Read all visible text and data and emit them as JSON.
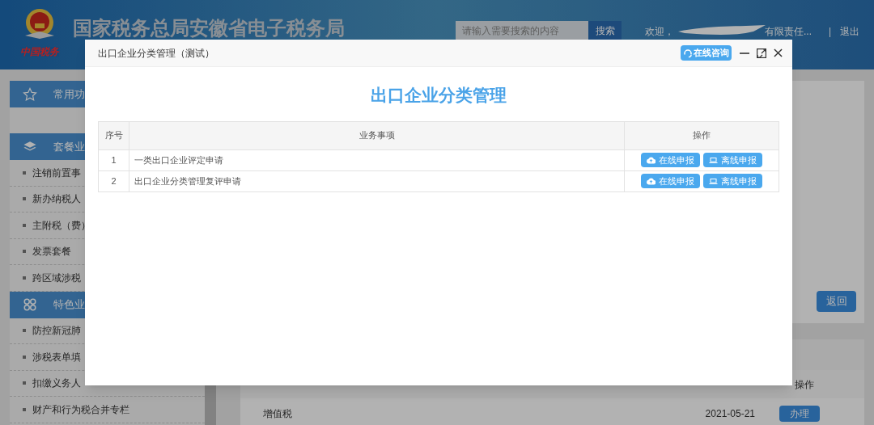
{
  "header": {
    "site_title": "国家税务总局安徽省电子税务局",
    "logo_text": "中国税务",
    "search": {
      "placeholder": "请输入需要搜索的内容",
      "button": "搜索"
    },
    "welcome": "欢迎，",
    "company": "有限责任...",
    "separator": "|",
    "logout": "退出"
  },
  "sidebar": {
    "sections": [
      {
        "kind": "star",
        "title": "常用功"
      },
      {
        "kind": "layers",
        "title": "套餐业",
        "items": [
          "注销前置事",
          "新办纳税人",
          "主附税（费）",
          "发票套餐",
          "跨区域涉税"
        ]
      },
      {
        "kind": "grid",
        "title": "特色业",
        "items": [
          "防控新冠肺",
          "涉税表单填",
          "扣缴义务人",
          "财产和行为税合并专栏"
        ]
      }
    ]
  },
  "main": {
    "back_button": "返回",
    "table": {
      "action_header": "操作",
      "rows": [
        {
          "name": "增值税",
          "date": "2021-05-21",
          "action": "办理"
        }
      ]
    }
  },
  "modal": {
    "title": "出口企业分类管理（测试）",
    "consult_button": "在线咨询",
    "heading": "出口企业分类管理",
    "columns": [
      "序号",
      "业务事项",
      "操作"
    ],
    "rows": [
      {
        "index": "1",
        "item": "一类出口企业评定申请",
        "actions": [
          {
            "kind": "online",
            "label": "在线申报"
          },
          {
            "kind": "offline",
            "label": "离线申报"
          }
        ]
      },
      {
        "index": "2",
        "item": "出口企业分类管理复评申请",
        "actions": [
          {
            "kind": "online",
            "label": "在线申报"
          },
          {
            "kind": "offline",
            "label": "离线申报"
          }
        ]
      }
    ]
  }
}
